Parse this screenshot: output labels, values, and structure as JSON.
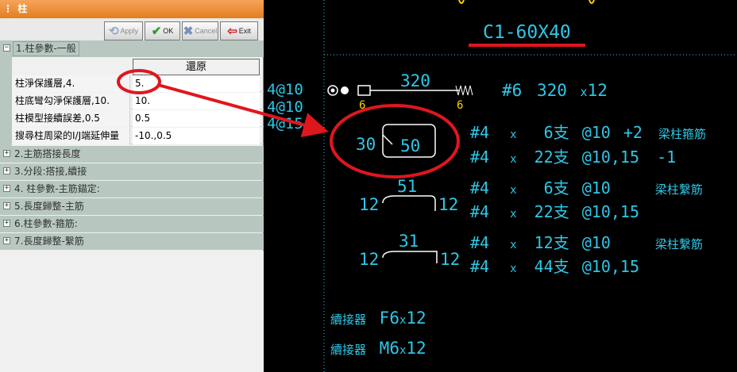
{
  "window": {
    "title": "柱"
  },
  "toolbar": {
    "apply_label": "Apply",
    "ok_label": "OK",
    "cancel_label": "Cancel",
    "exit_label": "Exit"
  },
  "grid": {
    "categories": [
      {
        "label": "1.柱參數-一般",
        "expander": "−"
      },
      {
        "label": "2.主筋搭接長度",
        "expander": "+"
      },
      {
        "label": "3.分段:搭接,續接",
        "expander": "+"
      },
      {
        "label": "4. 柱參數-主筋錨定:",
        "expander": "+"
      },
      {
        "label": "5.長度歸整-主筋",
        "expander": "+"
      },
      {
        "label": "6.柱參數-箍筋:",
        "expander": "+"
      },
      {
        "label": "7.長度歸整-繫筋",
        "expander": "+"
      }
    ],
    "restore_label": "還原",
    "rows": [
      {
        "key": "柱淨保護層,4.",
        "value": "5."
      },
      {
        "key": "柱底彎勾淨保護層,10.",
        "value": "10."
      },
      {
        "key": "柱模型接續誤差,0.5",
        "value": "0.5"
      },
      {
        "key": "搜尋柱周梁的I/J端延伸量",
        "value": "-10.,0.5"
      }
    ]
  },
  "cad": {
    "column_title": "C1-60X40",
    "left_labels": [
      "4@10",
      "4@10",
      "4@15"
    ],
    "main_bar_length": "320",
    "main_hook_left": "6",
    "main_hook_right": "6",
    "main_spec": {
      "bar": "#6",
      "length": "320",
      "mult": "x",
      "count": "12"
    },
    "stirrup": {
      "side_a": "30",
      "side_b": "50"
    },
    "stirrup_lines": [
      {
        "bar": "#4",
        "mult": "x",
        "count": "6支",
        "spacing": "@10",
        "extra": "+2",
        "note": "梁柱箍筋"
      },
      {
        "bar": "#4",
        "mult": "x",
        "count": "22支",
        "spacing": "@10,15",
        "extra": "-1",
        "note": ""
      }
    ],
    "tie1": {
      "length": "51",
      "hook_left": "12",
      "hook_right": "12"
    },
    "tie1_lines": [
      {
        "bar": "#4",
        "mult": "x",
        "count": "6支",
        "spacing": "@10",
        "note": "梁柱繫筋"
      },
      {
        "bar": "#4",
        "mult": "x",
        "count": "22支",
        "spacing": "@10,15",
        "note": ""
      }
    ],
    "tie2": {
      "length": "31",
      "hook_left": "12",
      "hook_right": "12"
    },
    "tie2_lines": [
      {
        "bar": "#4",
        "mult": "x",
        "count": "12支",
        "spacing": "@10",
        "note": "梁柱繫筋"
      },
      {
        "bar": "#4",
        "mult": "x",
        "count": "44支",
        "spacing": "@10,15",
        "note": ""
      }
    ],
    "couplers": [
      {
        "label": "續接器",
        "spec": "F6",
        "mult": "x",
        "count": "12"
      },
      {
        "label": "續接器",
        "spec": "M6",
        "mult": "x",
        "count": "12"
      }
    ]
  },
  "colors": {
    "cad_text": "#2ec7e6",
    "cad_dim": "#ffd400",
    "annotation_red": "#e0161e",
    "title_bar": "#e8892a",
    "category_bg": "#b8c8c0"
  }
}
